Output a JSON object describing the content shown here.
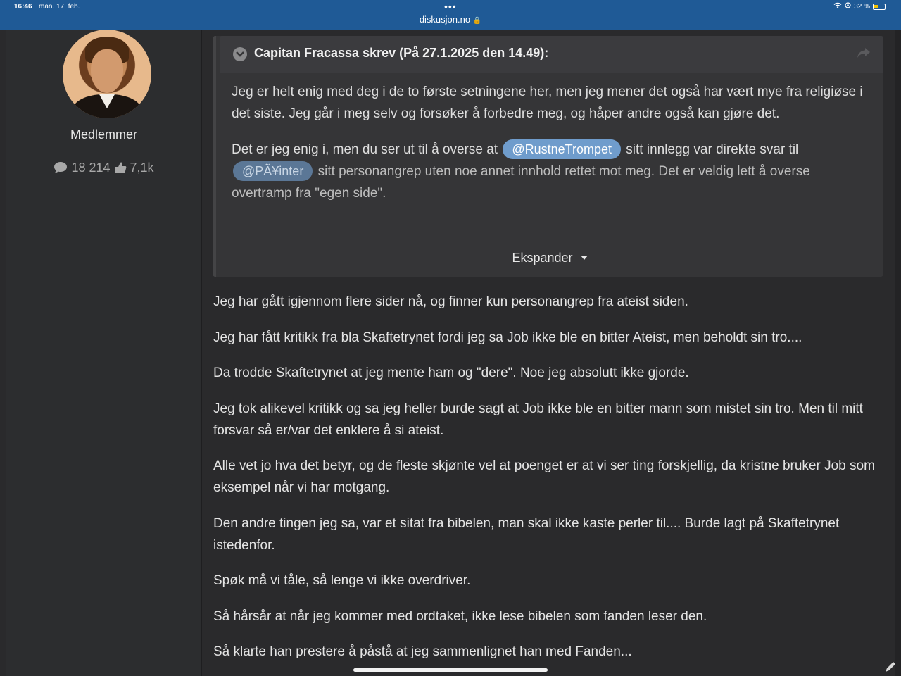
{
  "status_bar": {
    "time": "16:46",
    "date": "man. 17. feb.",
    "url": "diskusjon.no",
    "battery": "32 %"
  },
  "author": {
    "role": "Medlemmer",
    "posts_count": "18 214",
    "reputation": "7,1k"
  },
  "quote": {
    "cite": "Capitan Fracassa skrev (På 27.1.2025 den 14.49):",
    "paragraph1": "Jeg er helt enig med deg i de to første setningene her, men jeg mener det også har vært mye fra religiøse i det siste. Jeg går i meg selv og forsøker å forbedre meg, og håper andre også kan gjøre det.",
    "p2_before": "Det er jeg enig i, men du ser ut til å overse at ",
    "mention1": "@RustneTrompet",
    "p2_middle": " sitt innlegg var direkte svar til ",
    "mention2": "@PÃ¥inter",
    "p2_after": " sitt personangrep uten noe annet innhold rettet mot meg. Det er veldig lett å overse overtramp fra \"egen side\".",
    "expand_label": "Ekspander"
  },
  "post": {
    "paragraphs": [
      "Jeg har gått igjennom flere sider nå, og finner kun personangrep fra ateist siden.",
      "Jeg har fått kritikk fra bla Skaftetrynet fordi jeg sa Job ikke ble en bitter Ateist, men beholdt sin tro....",
      "Da trodde Skaftetrynet at jeg mente ham og \"dere\". Noe jeg absolutt ikke gjorde.",
      "Jeg tok alikevel kritikk og sa jeg heller burde sagt at Job ikke ble en bitter mann som mistet sin tro. Men til mitt forsvar så er/var det enklere å si ateist.",
      "Alle vet jo hva det betyr, og de fleste skjønte vel at poenget er at vi ser ting forskjellig, da kristne bruker Job som eksempel når vi har motgang.",
      "Den andre tingen jeg sa, var et sitat fra bibelen, man skal ikke kaste perler til.... Burde lagt på Skaftetrynet istedenfor.",
      "Spøk må vi tåle, så lenge vi ikke overdriver.",
      "Så hårsår at når jeg kommer med ordtaket, ikke lese bibelen som fanden leser den.",
      "Så klarte han prestere å påstå at jeg sammenlignet han med Fanden..."
    ]
  },
  "colors": {
    "browser_bar": "#1f5a96",
    "page_bg": "#2a2a2c",
    "mention": "#6f9ccc"
  }
}
